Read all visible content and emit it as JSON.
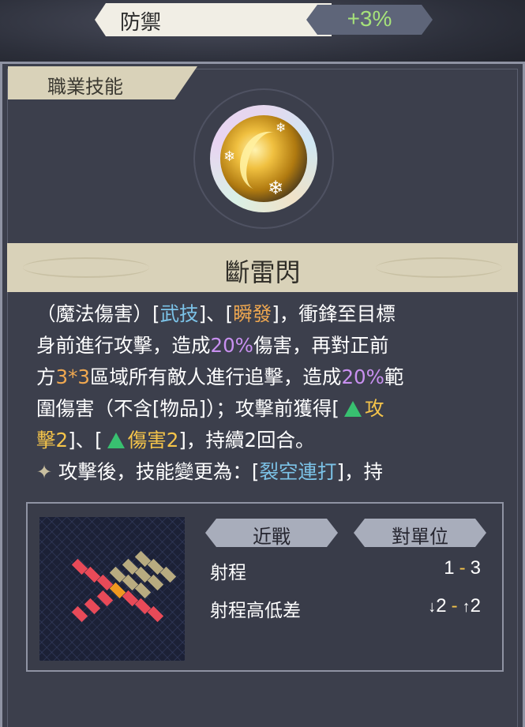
{
  "stat": {
    "label": "防禦",
    "value": "+3%"
  },
  "section": {
    "title": "職業技能"
  },
  "skill": {
    "icon": "golden-slash-snowflake-icon",
    "name": "斷雷閃",
    "desc": {
      "l1_a": "（魔法傷害）[",
      "l1_b": "武技",
      "l1_c": "]、[",
      "l1_d": "瞬發",
      "l1_e": "]，衝鋒至目標",
      "l2_a": "身前進行攻擊，造成",
      "l2_b": "20%",
      "l2_c": "傷害，再對正前",
      "l3_a": "方",
      "l3_b": "3*3",
      "l3_c": "區域所有敵人進行追擊，造成",
      "l3_d": "20%",
      "l3_e": "範",
      "l4_a": "圍傷害（不含[物品]）；攻擊前獲得[",
      "l4_b": "攻",
      "l5_a": "擊2",
      "l5_b": "]、[",
      "l5_c": "傷害2",
      "l5_d": "]，持續2回合。",
      "l6_a": "攻擊後，技能變更為：[",
      "l6_b": "裂空連打",
      "l6_c": "]，持"
    }
  },
  "info": {
    "tag_left": "近戰",
    "tag_right": "對單位",
    "range_label": "射程",
    "range_min": "1",
    "range_sep": "-",
    "range_max": "3",
    "height_label": "射程高低差",
    "height_down": "2",
    "height_sep": "-",
    "height_up": "2"
  },
  "colors": {
    "highlight_blue": "#7cc3e8",
    "highlight_orange": "#f0a850",
    "highlight_purple": "#c890f0",
    "highlight_gold": "#f5c44a",
    "buff_green": "#38c070",
    "stat_green": "#a6e27a"
  }
}
